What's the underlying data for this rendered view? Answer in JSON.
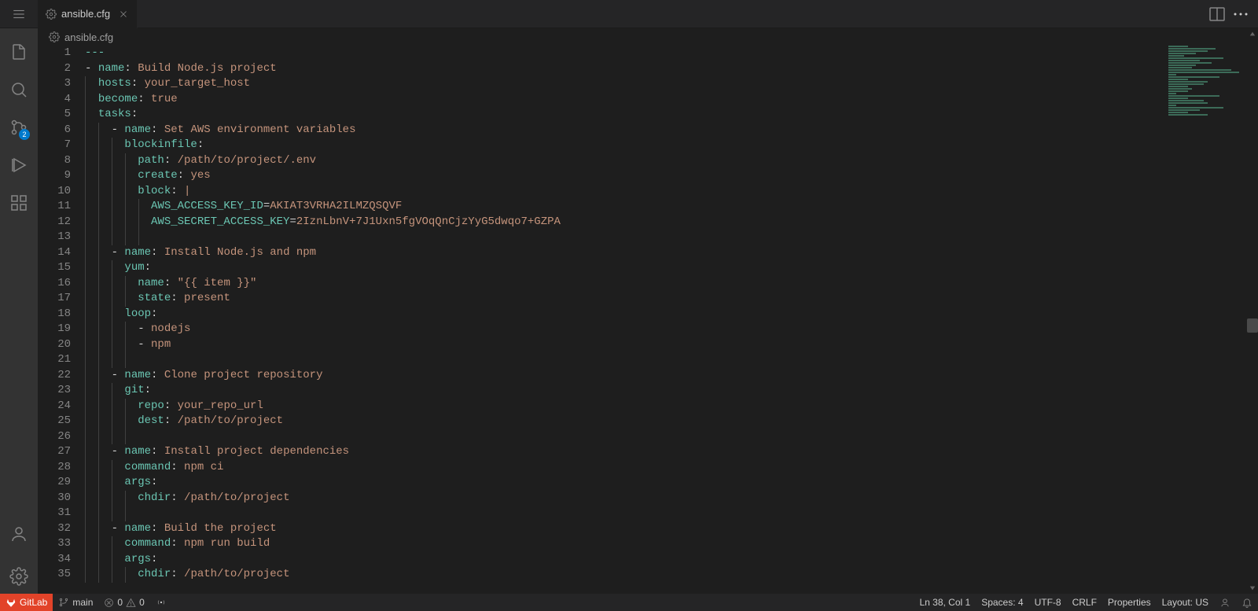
{
  "tab": {
    "label": "ansible.cfg"
  },
  "breadcrumb": {
    "label": "ansible.cfg"
  },
  "sidebar": {
    "scm_badge": "2"
  },
  "editor": {
    "lines": [
      {
        "n": 1,
        "ind": 0,
        "seg": [
          {
            "c": "k",
            "t": "---"
          }
        ]
      },
      {
        "n": 2,
        "ind": 0,
        "seg": [
          {
            "c": "p",
            "t": "- "
          },
          {
            "c": "k",
            "t": "name"
          },
          {
            "c": "p",
            "t": ": "
          },
          {
            "c": "s",
            "t": "Build Node.js project"
          }
        ]
      },
      {
        "n": 3,
        "ind": 1,
        "seg": [
          {
            "c": "p",
            "t": "  "
          },
          {
            "c": "k",
            "t": "hosts"
          },
          {
            "c": "p",
            "t": ": "
          },
          {
            "c": "s",
            "t": "your_target_host"
          }
        ]
      },
      {
        "n": 4,
        "ind": 1,
        "seg": [
          {
            "c": "p",
            "t": "  "
          },
          {
            "c": "k",
            "t": "become"
          },
          {
            "c": "p",
            "t": ": "
          },
          {
            "c": "s",
            "t": "true"
          }
        ]
      },
      {
        "n": 5,
        "ind": 1,
        "seg": [
          {
            "c": "p",
            "t": "  "
          },
          {
            "c": "k",
            "t": "tasks"
          },
          {
            "c": "p",
            "t": ":"
          }
        ]
      },
      {
        "n": 6,
        "ind": 2,
        "seg": [
          {
            "c": "p",
            "t": "    - "
          },
          {
            "c": "k",
            "t": "name"
          },
          {
            "c": "p",
            "t": ": "
          },
          {
            "c": "s",
            "t": "Set AWS environment variables"
          }
        ]
      },
      {
        "n": 7,
        "ind": 3,
        "seg": [
          {
            "c": "p",
            "t": "      "
          },
          {
            "c": "k",
            "t": "blockinfile"
          },
          {
            "c": "p",
            "t": ":"
          }
        ]
      },
      {
        "n": 8,
        "ind": 4,
        "seg": [
          {
            "c": "p",
            "t": "        "
          },
          {
            "c": "k",
            "t": "path"
          },
          {
            "c": "p",
            "t": ": "
          },
          {
            "c": "s",
            "t": "/path/to/project/.env"
          }
        ]
      },
      {
        "n": 9,
        "ind": 4,
        "seg": [
          {
            "c": "p",
            "t": "        "
          },
          {
            "c": "k",
            "t": "create"
          },
          {
            "c": "p",
            "t": ": "
          },
          {
            "c": "s",
            "t": "yes"
          }
        ]
      },
      {
        "n": 10,
        "ind": 4,
        "seg": [
          {
            "c": "p",
            "t": "        "
          },
          {
            "c": "k",
            "t": "block"
          },
          {
            "c": "p",
            "t": ": "
          },
          {
            "c": "s",
            "t": "|"
          }
        ]
      },
      {
        "n": 11,
        "ind": 5,
        "seg": [
          {
            "c": "p",
            "t": "          "
          },
          {
            "c": "k",
            "t": "AWS_ACCESS_KEY_ID"
          },
          {
            "c": "p",
            "t": "="
          },
          {
            "c": "s",
            "t": "AKIAT3VRHA2ILMZQSQVF"
          }
        ]
      },
      {
        "n": 12,
        "ind": 5,
        "seg": [
          {
            "c": "p",
            "t": "          "
          },
          {
            "c": "k",
            "t": "AWS_SECRET_ACCESS_KEY"
          },
          {
            "c": "p",
            "t": "="
          },
          {
            "c": "s",
            "t": "2IznLbnV+7J1Uxn5fgVOqQnCjzYyG5dwqo7+GZPA"
          }
        ]
      },
      {
        "n": 13,
        "ind": 5,
        "seg": []
      },
      {
        "n": 14,
        "ind": 2,
        "seg": [
          {
            "c": "p",
            "t": "    - "
          },
          {
            "c": "k",
            "t": "name"
          },
          {
            "c": "p",
            "t": ": "
          },
          {
            "c": "s",
            "t": "Install Node.js and npm"
          }
        ]
      },
      {
        "n": 15,
        "ind": 3,
        "seg": [
          {
            "c": "p",
            "t": "      "
          },
          {
            "c": "k",
            "t": "yum"
          },
          {
            "c": "p",
            "t": ":"
          }
        ]
      },
      {
        "n": 16,
        "ind": 4,
        "seg": [
          {
            "c": "p",
            "t": "        "
          },
          {
            "c": "k",
            "t": "name"
          },
          {
            "c": "p",
            "t": ": "
          },
          {
            "c": "s",
            "t": "\"{{ item }}\""
          }
        ]
      },
      {
        "n": 17,
        "ind": 4,
        "seg": [
          {
            "c": "p",
            "t": "        "
          },
          {
            "c": "k",
            "t": "state"
          },
          {
            "c": "p",
            "t": ": "
          },
          {
            "c": "s",
            "t": "present"
          }
        ]
      },
      {
        "n": 18,
        "ind": 3,
        "seg": [
          {
            "c": "p",
            "t": "      "
          },
          {
            "c": "k",
            "t": "loop"
          },
          {
            "c": "p",
            "t": ":"
          }
        ]
      },
      {
        "n": 19,
        "ind": 4,
        "seg": [
          {
            "c": "p",
            "t": "        - "
          },
          {
            "c": "s",
            "t": "nodejs"
          }
        ]
      },
      {
        "n": 20,
        "ind": 4,
        "seg": [
          {
            "c": "p",
            "t": "        - "
          },
          {
            "c": "s",
            "t": "npm"
          }
        ]
      },
      {
        "n": 21,
        "ind": 4,
        "seg": []
      },
      {
        "n": 22,
        "ind": 2,
        "seg": [
          {
            "c": "p",
            "t": "    - "
          },
          {
            "c": "k",
            "t": "name"
          },
          {
            "c": "p",
            "t": ": "
          },
          {
            "c": "s",
            "t": "Clone project repository"
          }
        ]
      },
      {
        "n": 23,
        "ind": 3,
        "seg": [
          {
            "c": "p",
            "t": "      "
          },
          {
            "c": "k",
            "t": "git"
          },
          {
            "c": "p",
            "t": ":"
          }
        ]
      },
      {
        "n": 24,
        "ind": 4,
        "seg": [
          {
            "c": "p",
            "t": "        "
          },
          {
            "c": "k",
            "t": "repo"
          },
          {
            "c": "p",
            "t": ": "
          },
          {
            "c": "s",
            "t": "your_repo_url"
          }
        ]
      },
      {
        "n": 25,
        "ind": 4,
        "seg": [
          {
            "c": "p",
            "t": "        "
          },
          {
            "c": "k",
            "t": "dest"
          },
          {
            "c": "p",
            "t": ": "
          },
          {
            "c": "s",
            "t": "/path/to/project"
          }
        ]
      },
      {
        "n": 26,
        "ind": 4,
        "seg": []
      },
      {
        "n": 27,
        "ind": 2,
        "seg": [
          {
            "c": "p",
            "t": "    - "
          },
          {
            "c": "k",
            "t": "name"
          },
          {
            "c": "p",
            "t": ": "
          },
          {
            "c": "s",
            "t": "Install project dependencies"
          }
        ]
      },
      {
        "n": 28,
        "ind": 3,
        "seg": [
          {
            "c": "p",
            "t": "      "
          },
          {
            "c": "k",
            "t": "command"
          },
          {
            "c": "p",
            "t": ": "
          },
          {
            "c": "s",
            "t": "npm ci"
          }
        ]
      },
      {
        "n": 29,
        "ind": 3,
        "seg": [
          {
            "c": "p",
            "t": "      "
          },
          {
            "c": "k",
            "t": "args"
          },
          {
            "c": "p",
            "t": ":"
          }
        ]
      },
      {
        "n": 30,
        "ind": 4,
        "seg": [
          {
            "c": "p",
            "t": "        "
          },
          {
            "c": "k",
            "t": "chdir"
          },
          {
            "c": "p",
            "t": ": "
          },
          {
            "c": "s",
            "t": "/path/to/project"
          }
        ]
      },
      {
        "n": 31,
        "ind": 4,
        "seg": []
      },
      {
        "n": 32,
        "ind": 2,
        "seg": [
          {
            "c": "p",
            "t": "    - "
          },
          {
            "c": "k",
            "t": "name"
          },
          {
            "c": "p",
            "t": ": "
          },
          {
            "c": "s",
            "t": "Build the project"
          }
        ]
      },
      {
        "n": 33,
        "ind": 3,
        "seg": [
          {
            "c": "p",
            "t": "      "
          },
          {
            "c": "k",
            "t": "command"
          },
          {
            "c": "p",
            "t": ": "
          },
          {
            "c": "s",
            "t": "npm run build"
          }
        ]
      },
      {
        "n": 34,
        "ind": 3,
        "seg": [
          {
            "c": "p",
            "t": "      "
          },
          {
            "c": "k",
            "t": "args"
          },
          {
            "c": "p",
            "t": ":"
          }
        ]
      },
      {
        "n": 35,
        "ind": 4,
        "seg": [
          {
            "c": "p",
            "t": "        "
          },
          {
            "c": "k",
            "t": "chdir"
          },
          {
            "c": "p",
            "t": ": "
          },
          {
            "c": "s",
            "t": "/path/to/project"
          }
        ]
      }
    ]
  },
  "statusbar": {
    "gitlab": "GitLab",
    "branch": "main",
    "errors": "0",
    "warnings": "0",
    "cursor": "Ln 38, Col 1",
    "spaces": "Spaces: 4",
    "encoding": "UTF-8",
    "eol": "CRLF",
    "lang": "Properties",
    "layout": "Layout: US"
  }
}
